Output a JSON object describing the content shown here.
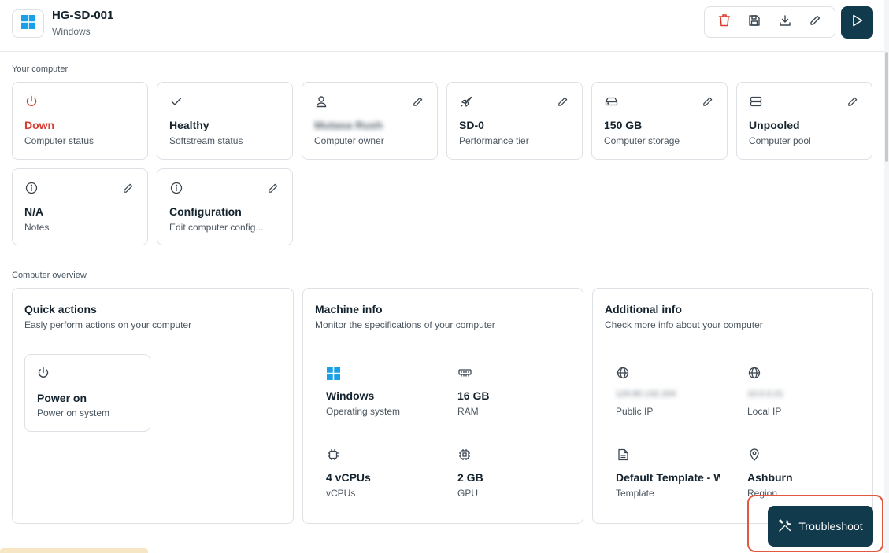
{
  "header": {
    "title": "HG-SD-001",
    "subtitle": "Windows",
    "os_icon": "windows-logo-icon",
    "toolbar": [
      "trash-icon",
      "save-icon",
      "download-icon",
      "pencil-icon"
    ],
    "primary_action_icon": "play-icon"
  },
  "colors": {
    "accent": "#123a4d",
    "danger": "#d93b30",
    "windows_blue": "#1aa0e8",
    "highlight_outline": "#e3573f"
  },
  "sections": {
    "your_computer": "Your computer",
    "computer_overview": "Computer overview"
  },
  "status_cards": [
    {
      "icon": "power-icon",
      "value": "Down",
      "label": "Computer status",
      "editable": false
    },
    {
      "icon": "check-icon",
      "value": "Healthy",
      "label": "Softstream status",
      "editable": false
    },
    {
      "icon": "user-icon",
      "value": "Mutasa Rush",
      "label": "Computer owner",
      "editable": true
    },
    {
      "icon": "rocket-icon",
      "value": "SD-0",
      "label": "Performance tier",
      "editable": true
    },
    {
      "icon": "storage-icon",
      "value": "150 GB",
      "label": "Computer storage",
      "editable": true
    },
    {
      "icon": "pool-icon",
      "value": "Unpooled",
      "label": "Computer pool",
      "editable": true
    },
    {
      "icon": "info-icon",
      "value": "N/A",
      "label": "Notes",
      "editable": true
    },
    {
      "icon": "info-icon",
      "value": "Configuration",
      "label": "Edit computer config...",
      "editable": true
    }
  ],
  "quick_actions": {
    "title": "Quick actions",
    "subtitle": "Easly perform actions on your computer",
    "actions": [
      {
        "icon": "power-icon",
        "value": "Power on",
        "label": "Power on system"
      }
    ]
  },
  "machine_info": {
    "title": "Machine info",
    "subtitle": "Monitor the specifications of your computer",
    "items": [
      {
        "icon": "windows-logo-icon",
        "value": "Windows",
        "label": "Operating system"
      },
      {
        "icon": "ram-icon",
        "value": "16 GB",
        "label": "RAM"
      },
      {
        "icon": "cpu-icon",
        "value": "4 vCPUs",
        "label": "vCPUs"
      },
      {
        "icon": "gpu-icon",
        "value": "2 GB",
        "label": "GPU"
      }
    ]
  },
  "additional_info": {
    "title": "Additional info",
    "subtitle": "Check more info about your computer",
    "items": [
      {
        "icon": "globe-icon",
        "value": "129.80.132.204",
        "label": "Public IP"
      },
      {
        "icon": "globe-icon",
        "value": "10.0.0.21",
        "label": "Local IP"
      },
      {
        "icon": "document-icon",
        "value": "Default Template - Windows",
        "label": "Template"
      },
      {
        "icon": "location-pin-icon",
        "value": "Ashburn",
        "label": "Region"
      }
    ]
  },
  "troubleshoot": {
    "label": "Troubleshoot",
    "icon": "tools-icon"
  }
}
